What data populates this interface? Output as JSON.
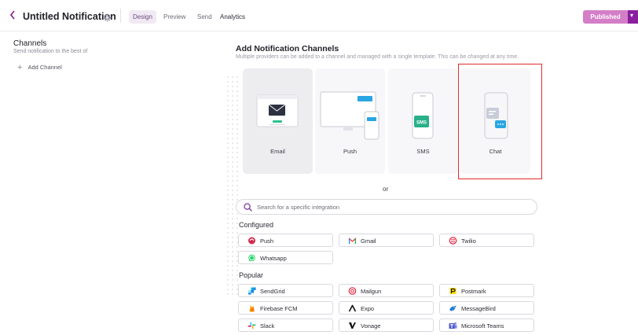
{
  "header": {
    "back_icon": "chevron-left-icon",
    "title": "Untitled Notification",
    "settings_icon": "gear-icon",
    "tabs": [
      {
        "label": "Design"
      },
      {
        "label": "Preview"
      },
      {
        "label": "Send"
      },
      {
        "label": "Analytics"
      }
    ],
    "published_label": "Published",
    "accent": "#8a1fa0"
  },
  "sidebar": {
    "title": "Channels",
    "subtitle": "Send notification to the best of",
    "add_channel_label": "Add Channel"
  },
  "main": {
    "title": "Add Notification Channels",
    "subtitle": "Multiple providers can be added to a channel and managed with a single template. This can be changed at any time.",
    "channels": [
      {
        "label": "Email",
        "icon": "email-illustration"
      },
      {
        "label": "Push",
        "icon": "push-illustration"
      },
      {
        "label": "SMS",
        "icon": "sms-illustration"
      },
      {
        "label": "Chat",
        "icon": "chat-illustration"
      }
    ],
    "or_label": "or",
    "search_placeholder": "Search for a specific integration",
    "configured_title": "Configured",
    "configured": [
      {
        "label": "Push",
        "icon": "push-logo-icon",
        "color": "#d42b4e"
      },
      {
        "label": "Gmail",
        "icon": "gmail-icon",
        "color": "#ea4335"
      },
      {
        "label": "Twilio",
        "icon": "twilio-icon",
        "color": "#e31e3a"
      },
      {
        "label": "Whatsapp",
        "icon": "whatsapp-icon",
        "color": "#25d366"
      }
    ],
    "popular_title": "Popular",
    "popular": [
      {
        "label": "SendGrid",
        "icon": "sendgrid-icon",
        "color": "#1a82e2"
      },
      {
        "label": "Mailgun",
        "icon": "mailgun-icon",
        "color": "#e0243a"
      },
      {
        "label": "Postmark",
        "icon": "postmark-icon",
        "color": "#1a1a1a"
      },
      {
        "label": "Firebase FCM",
        "icon": "firebase-icon",
        "color": "#ffa000"
      },
      {
        "label": "Expo",
        "icon": "expo-icon",
        "color": "#111111"
      },
      {
        "label": "MessageBird",
        "icon": "messagebird-icon",
        "color": "#2481d7"
      },
      {
        "label": "Slack",
        "icon": "slack-icon",
        "color": "#e01e5a"
      },
      {
        "label": "Vonage",
        "icon": "vonage-icon",
        "color": "#111111"
      },
      {
        "label": "Microsoft Teams",
        "icon": "microsoft-teams-icon",
        "color": "#5059c9"
      }
    ]
  }
}
